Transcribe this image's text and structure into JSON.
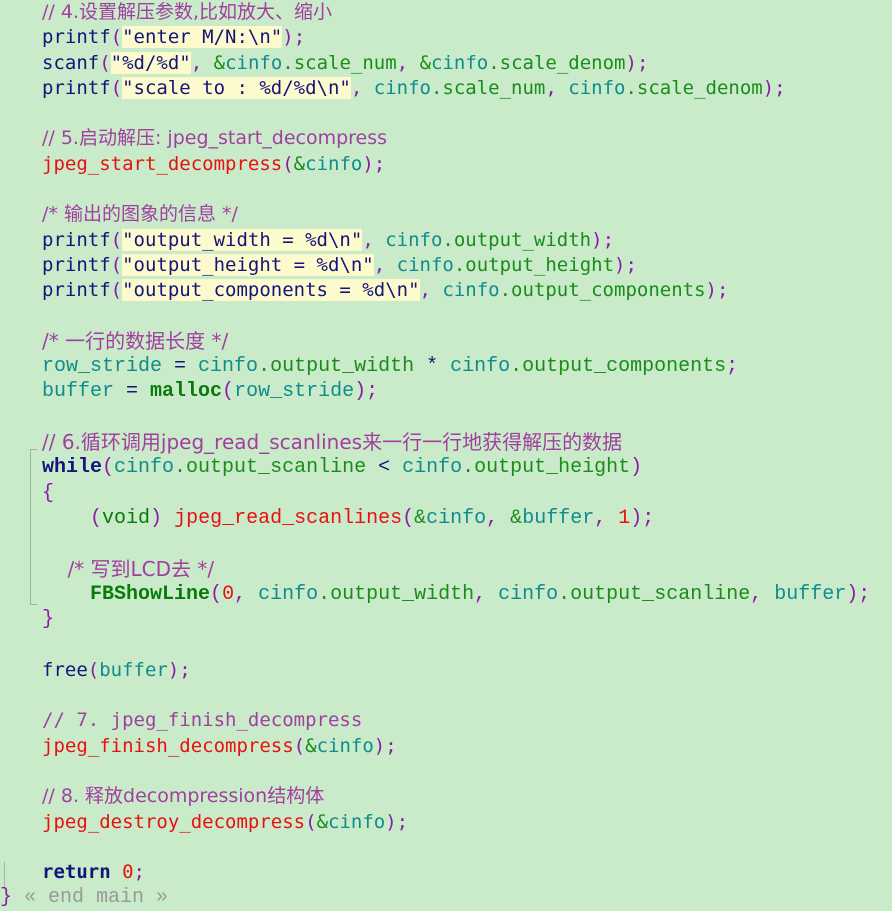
{
  "editor": {
    "background_color": "#c9ebc9",
    "string_highlight_color": "#fdfbce",
    "language": "C",
    "fold_label": "« end main »"
  },
  "lines": [
    {
      "id": "l1",
      "text": "// 4.设置解压参数,比如放大、缩小"
    },
    {
      "id": "l2",
      "text": "printf(\"enter M/N:\\n\");"
    },
    {
      "id": "l3",
      "text": "scanf(\"%d/%d\", &cinfo.scale_num, &cinfo.scale_denom);"
    },
    {
      "id": "l4",
      "text": "printf(\"scale to : %d/%d\\n\", cinfo.scale_num, cinfo.scale_denom);"
    },
    {
      "id": "l5",
      "text": ""
    },
    {
      "id": "l6",
      "text": "// 5.启动解压: jpeg_start_decompress"
    },
    {
      "id": "l7",
      "text": "jpeg_start_decompress(&cinfo);"
    },
    {
      "id": "l8",
      "text": ""
    },
    {
      "id": "l9",
      "text": "/* 输出的图象的信息 */"
    },
    {
      "id": "l10",
      "text": "printf(\"output_width = %d\\n\", cinfo.output_width);"
    },
    {
      "id": "l11",
      "text": "printf(\"output_height = %d\\n\", cinfo.output_height);"
    },
    {
      "id": "l12",
      "text": "printf(\"output_components = %d\\n\", cinfo.output_components);"
    },
    {
      "id": "l13",
      "text": ""
    },
    {
      "id": "l14",
      "text": "/* 一行的数据长度 */"
    },
    {
      "id": "l15",
      "text": "row_stride = cinfo.output_width * cinfo.output_components;"
    },
    {
      "id": "l16",
      "text": "buffer = malloc(row_stride);"
    },
    {
      "id": "l17",
      "text": ""
    },
    {
      "id": "l18",
      "text": "// 6.循环调用jpeg_read_scanlines来一行一行地获得解压的数据"
    },
    {
      "id": "l19",
      "text": "while(cinfo.output_scanline < cinfo.output_height)"
    },
    {
      "id": "l20",
      "text": "{"
    },
    {
      "id": "l21",
      "text": "    (void) jpeg_read_scanlines(&cinfo, &buffer, 1);"
    },
    {
      "id": "l22",
      "text": ""
    },
    {
      "id": "l23",
      "text": "    /* 写到LCD去 */"
    },
    {
      "id": "l24",
      "text": "    FBShowLine(0, cinfo.output_width, cinfo.output_scanline, buffer);"
    },
    {
      "id": "l25",
      "text": "}"
    },
    {
      "id": "l26",
      "text": ""
    },
    {
      "id": "l27",
      "text": "free(buffer);"
    },
    {
      "id": "l28",
      "text": ""
    },
    {
      "id": "l29",
      "text": "// 7. jpeg_finish_decompress"
    },
    {
      "id": "l30",
      "text": "jpeg_finish_decompress(&cinfo);"
    },
    {
      "id": "l31",
      "text": ""
    },
    {
      "id": "l32",
      "text": "// 8. 释放decompression结构体"
    },
    {
      "id": "l33",
      "text": "jpeg_destroy_decompress(&cinfo);"
    },
    {
      "id": "l34",
      "text": ""
    },
    {
      "id": "l35",
      "text": "return 0;"
    },
    {
      "id": "l36",
      "text": "} « end main »"
    }
  ],
  "tokens": {
    "comment_4": "// 4.设置解压参数,比如放大、缩小",
    "comment_5": "// 5.启动解压: jpeg_start_decompress",
    "comment_out": "/* 输出的图象的信息 */",
    "comment_row": "/* 一行的数据长度 */",
    "comment_6": "// 6.循环调用jpeg_read_scanlines来一行一行地获得解压的数据",
    "comment_lcd": "/* 写到LCD去 */",
    "comment_7": "// 7. jpeg_finish_decompress",
    "comment_8": "// 8. 释放decompression结构体",
    "str_enter": "\"enter M/N:\\n\"",
    "str_dd": "\"%d/%d\"",
    "str_scale": "\"scale to : %d/%d\\n\"",
    "str_width": "\"output_width = %d\\n\"",
    "str_height": "\"output_height = %d\\n\"",
    "str_comp": "\"output_components = %d\\n\"",
    "fn_printf": "printf",
    "fn_scanf": "scanf",
    "fn_free": "free",
    "fn_malloc": "malloc",
    "fn_fbshow": "FBShowLine",
    "lib_start": "jpeg_start_decompress",
    "lib_read": "jpeg_read_scanlines",
    "lib_finish": "jpeg_finish_decompress",
    "lib_destroy": "jpeg_destroy_decompress",
    "kw_while": "while",
    "kw_return": "return",
    "var_cinfo": "cinfo",
    "var_buffer": "buffer",
    "var_rowstride": "row_stride",
    "num_zero": "0",
    "num_one": "1",
    "fold_end": "« end main »"
  },
  "colors": {
    "background": "#c9ebc9",
    "comment": "#a13fa1",
    "function": "#14147a",
    "builtin": "#0a7a0a",
    "library_call": "#e81010",
    "keyword": "#14147a",
    "punctuation": "#8c1aa8",
    "variable": "#0f8c8c",
    "member": "#1a8c1a",
    "number": "#e81010",
    "string_text": "#14147a",
    "string_bg": "#fdfbce",
    "fold_guide": "#9ab99a",
    "fold_label": "#9a9a9a"
  }
}
